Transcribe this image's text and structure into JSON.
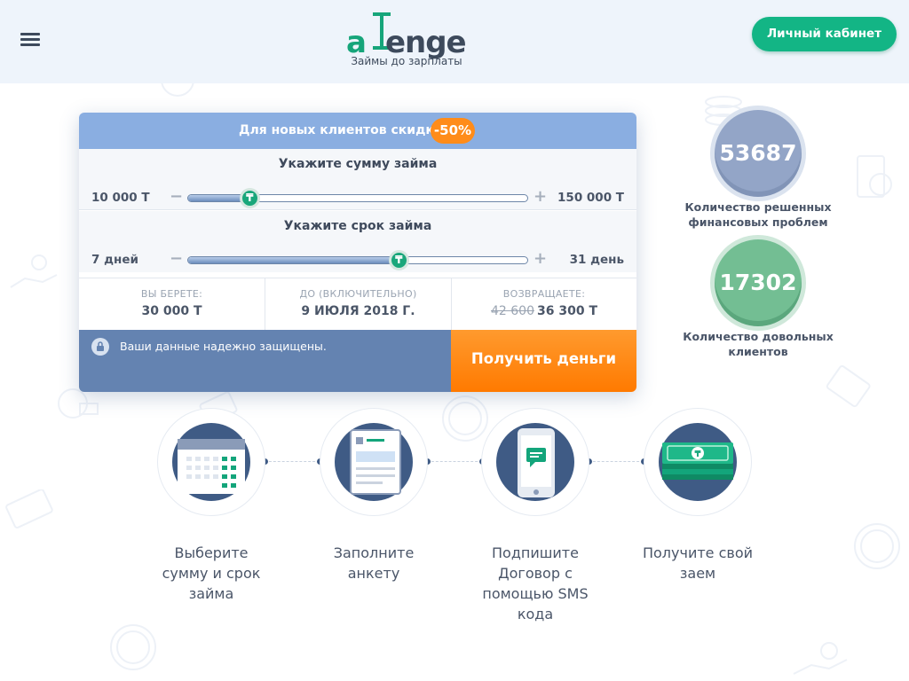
{
  "header": {
    "logo_text_a": "a",
    "logo_text_t": "T",
    "logo_text_rest": "enge",
    "tagline": "Займы до зарплаты",
    "cabinet_button": "Личный кабинет"
  },
  "calculator": {
    "promo_text": "Для новых клиентов скидка",
    "promo_badge": "-50%",
    "amount": {
      "title": "Укажите сумму займа",
      "min_label": "10 000 Т",
      "max_label": "150 000 Т",
      "fraction": 0.18
    },
    "term": {
      "title": "Укажите срок займа",
      "min_label": "7 дней",
      "max_label": "31 день",
      "fraction": 0.62
    },
    "knob_symbol": "₸",
    "minus": "−",
    "plus": "+",
    "summary": {
      "take_label": "ВЫ БЕРЕТЕ:",
      "take_value": "30 000 Т",
      "until_label": "ДО (ВКЛЮЧИТЕЛЬНО)",
      "until_value": "9 ИЮЛЯ 2018 Г.",
      "return_label": "ВОЗВРАЩАЕТЕ:",
      "return_old": "42 600",
      "return_new": "36 300 Т"
    },
    "secure_text": "Ваши данные надежно защищены.",
    "get_money_button": "Получить деньги"
  },
  "stats": [
    {
      "value": "53687",
      "label_1": "Количество решенных",
      "label_2": "финансовых проблем"
    },
    {
      "value": "17302",
      "label_1": "Количество довольных",
      "label_2": "клиентов"
    }
  ],
  "steps": [
    {
      "icon": "calendar-icon",
      "line_1": "Выберите",
      "line_2": "сумму и срок",
      "line_3": "займа",
      "line_4": ""
    },
    {
      "icon": "document-icon",
      "line_1": "Заполните",
      "line_2": "анкету",
      "line_3": "",
      "line_4": ""
    },
    {
      "icon": "phone-sms-icon",
      "line_1": "Подпишите",
      "line_2": "Договор с",
      "line_3": "помощью SMS",
      "line_4": "кода"
    },
    {
      "icon": "money-icon",
      "line_1": "Получите свой",
      "line_2": "заем",
      "line_3": "",
      "line_4": ""
    }
  ],
  "colors": {
    "brand_green": "#13b585",
    "accent_orange": "#ff8c1a",
    "card_blue": "#6483b1",
    "promo_blue": "#8aaee1"
  }
}
